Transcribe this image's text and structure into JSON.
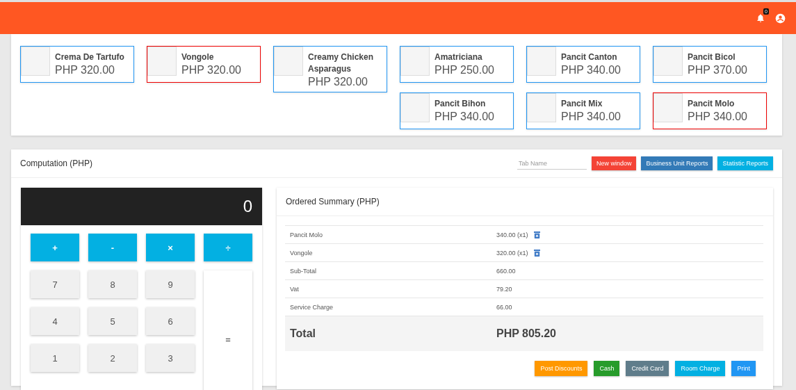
{
  "header": {
    "notification_count": "0"
  },
  "products": [
    {
      "name": "Crema De Tartufo",
      "price": "PHP 320.00",
      "selected": false
    },
    {
      "name": "Vongole",
      "price": "PHP 320.00",
      "selected": true
    },
    {
      "name": "Creamy Chicken Asparagus",
      "price": "PHP 320.00",
      "selected": false
    },
    {
      "name": "Amatriciana",
      "price": "PHP 250.00",
      "selected": false
    },
    {
      "name": "Pancit Canton",
      "price": "PHP 340.00",
      "selected": false
    },
    {
      "name": "Pancit Bicol",
      "price": "PHP 370.00",
      "selected": false
    },
    {
      "name": "Pancit Bihon",
      "price": "PHP 340.00",
      "selected": false
    },
    {
      "name": "Pancit Mix",
      "price": "PHP 340.00",
      "selected": false
    },
    {
      "name": "Pancit Molo",
      "price": "PHP 340.00",
      "selected": true
    }
  ],
  "computation": {
    "title": "Computation (PHP)",
    "tab_name": {
      "placeholder": "Tab Name"
    },
    "buttons": [
      {
        "label": "New window",
        "kind": "danger"
      },
      {
        "label": "Business Unit Reports",
        "kind": "primary"
      },
      {
        "label": "Statistic Reports",
        "kind": "info"
      }
    ]
  },
  "calculator": {
    "display": "0",
    "keys": [
      {
        "label": "+",
        "kind": "op"
      },
      {
        "label": "-",
        "kind": "op"
      },
      {
        "label": "×",
        "kind": "op"
      },
      {
        "label": "÷",
        "kind": "op"
      },
      {
        "label": "7",
        "kind": "digit"
      },
      {
        "label": "8",
        "kind": "digit"
      },
      {
        "label": "9",
        "kind": "digit"
      },
      {
        "label": "=",
        "kind": "equals"
      },
      {
        "label": "4",
        "kind": "digit"
      },
      {
        "label": "5",
        "kind": "digit"
      },
      {
        "label": "6",
        "kind": "digit"
      },
      {
        "label": "1",
        "kind": "digit"
      },
      {
        "label": "2",
        "kind": "digit"
      },
      {
        "label": "3",
        "kind": "digit"
      }
    ]
  },
  "summary": {
    "title": "Ordered Summary (PHP)",
    "rows": [
      {
        "label": "Pancit Molo",
        "value": "340.00 (x1)",
        "kind": "item"
      },
      {
        "label": "Vongole",
        "value": "320.00 (x1)",
        "kind": "item"
      },
      {
        "label": "Sub-Total",
        "value": "660.00",
        "kind": "line"
      },
      {
        "label": "Vat",
        "value": "79.20",
        "kind": "line"
      },
      {
        "label": "Service Charge",
        "value": "66.00",
        "kind": "line"
      }
    ],
    "total": {
      "label": "Total",
      "value": "PHP 805.20"
    },
    "buttons": [
      {
        "label": "Post Discounts",
        "kind": "warning"
      },
      {
        "label": "Cash",
        "kind": "success"
      },
      {
        "label": "Credit Card",
        "kind": "grey"
      },
      {
        "label": "Room Charge",
        "kind": "info"
      },
      {
        "label": "Print",
        "kind": "blue"
      }
    ]
  }
}
